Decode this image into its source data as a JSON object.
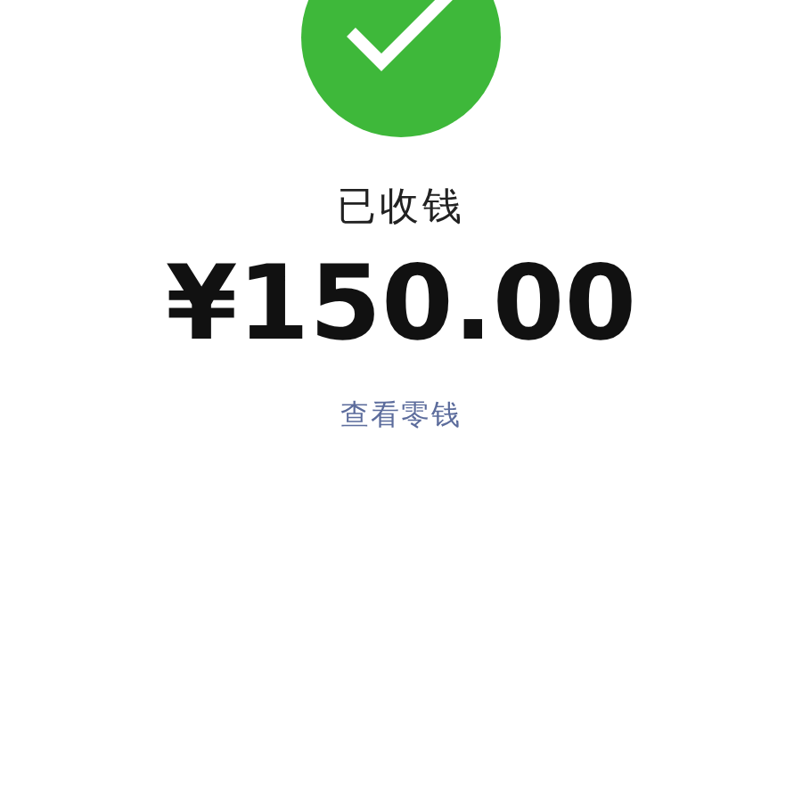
{
  "result": {
    "kind": "success",
    "title": "已收钱",
    "amount": "¥150.00",
    "link": "查看零钱"
  }
}
